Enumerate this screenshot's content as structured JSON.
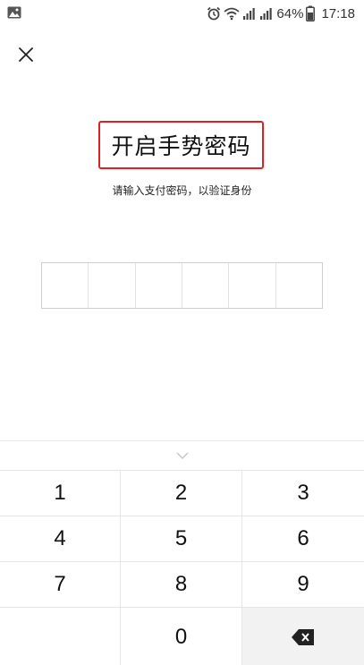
{
  "status_bar": {
    "battery": "64%",
    "time": "17:18",
    "icons": [
      "image-icon",
      "alarm-icon",
      "wifi-icon",
      "signal-icon",
      "signal-icon",
      "battery-icon"
    ]
  },
  "header": {
    "close_icon": "close-icon"
  },
  "main": {
    "title": "开启手势密码",
    "subtitle": "请输入支付密码，以验证身份",
    "pin_cells": 6
  },
  "keypad": {
    "collapse_icon": "chevron-down-icon",
    "keys": [
      "1",
      "2",
      "3",
      "4",
      "5",
      "6",
      "7",
      "8",
      "9",
      "",
      "0"
    ],
    "delete_icon": "backspace-icon"
  },
  "colors": {
    "highlight_border": "#e02020",
    "divider": "#e6e6e6",
    "delete_key_bg": "#f2f2f2"
  }
}
